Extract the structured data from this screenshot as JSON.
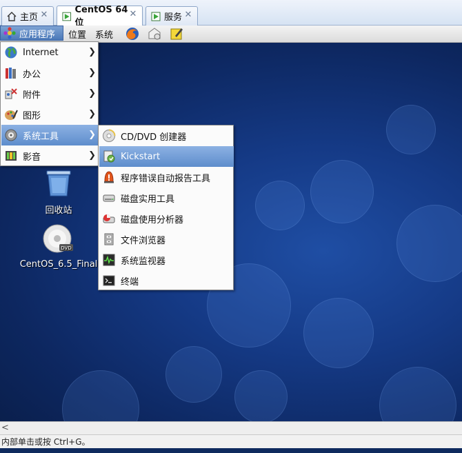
{
  "tabs": [
    {
      "label": "主页",
      "icon": "home-icon",
      "active": false
    },
    {
      "label": "CentOS 64 位",
      "icon": "vm-icon",
      "active": true
    },
    {
      "label": "服务",
      "icon": "vm-icon",
      "active": false
    }
  ],
  "panel": {
    "apps": "应用程序",
    "places": "位置",
    "system": "系统",
    "launchers": [
      "firefox-icon",
      "mail-icon",
      "note-edit-icon"
    ]
  },
  "app_menu": {
    "items": [
      {
        "label": "Internet",
        "icon": "globe-icon"
      },
      {
        "label": "办公",
        "icon": "office-icon"
      },
      {
        "label": "附件",
        "icon": "accessories-icon"
      },
      {
        "label": "图形",
        "icon": "graphics-icon"
      },
      {
        "label": "系统工具",
        "icon": "system-tools-icon",
        "highlighted": true
      },
      {
        "label": "影音",
        "icon": "multimedia-icon"
      }
    ]
  },
  "system_tools_menu": {
    "items": [
      {
        "label": "CD/DVD 创建器",
        "icon": "cd-icon"
      },
      {
        "label": "Kickstart",
        "icon": "kickstart-icon",
        "highlighted": true
      },
      {
        "label": "程序错误自动报告工具",
        "icon": "alert-icon"
      },
      {
        "label": "磁盘实用工具",
        "icon": "disk-icon"
      },
      {
        "label": "磁盘使用分析器",
        "icon": "disk-analyzer-icon"
      },
      {
        "label": "文件浏览器",
        "icon": "file-cabinet-icon"
      },
      {
        "label": "系统监视器",
        "icon": "monitor-icon"
      },
      {
        "label": "终端",
        "icon": "terminal-icon"
      }
    ]
  },
  "desktop_icons": [
    {
      "label": "回收站",
      "icon": "trash-icon"
    },
    {
      "label": "CentOS_6.5_Final",
      "icon": "dvd-icon",
      "badge": "DVD"
    }
  ],
  "scroll": {
    "left_arrow": "<"
  },
  "status": "内部单击或按 Ctrl+G。"
}
